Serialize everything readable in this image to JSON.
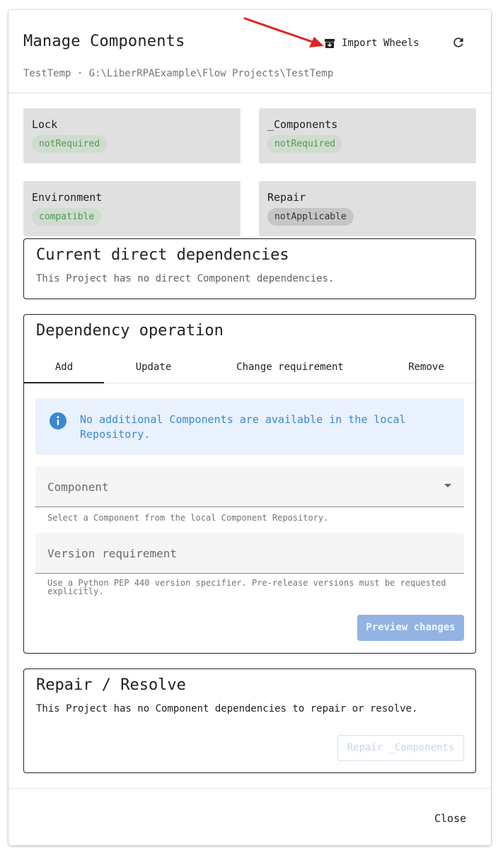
{
  "dialog": {
    "title": "Manage Components",
    "subtitle": "TestTemp · G:\\LiberRPAExample\\Flow Projects\\TestTemp",
    "import_label": "Import Wheels",
    "import_icon": "archive-icon",
    "refresh_icon": "refresh-icon",
    "annotation_color": "#e02424"
  },
  "status_cards": [
    {
      "label": "Lock",
      "value": "notRequired",
      "tone": "ok"
    },
    {
      "label": "_Components",
      "value": "notRequired",
      "tone": "ok"
    },
    {
      "label": "Environment",
      "value": "compatible",
      "tone": "ok"
    },
    {
      "label": "Repair",
      "value": "notApplicable",
      "tone": "neutral"
    }
  ],
  "current_deps": {
    "title": "Current direct dependencies",
    "text": "This Project has no direct Component dependencies."
  },
  "operation": {
    "title": "Dependency operation",
    "tabs": [
      {
        "label": "Add",
        "active": true
      },
      {
        "label": "Update",
        "active": false
      },
      {
        "label": "Change requirement",
        "active": false
      },
      {
        "label": "Remove",
        "active": false
      }
    ],
    "info_icon": "info-icon",
    "info_text": "No additional Components are available in the local Repository.",
    "component_field": {
      "placeholder": "Component",
      "helper": "Select a Component from the local Component Repository."
    },
    "version_field": {
      "placeholder": "Version requirement",
      "helper": "Use a Python PEP 440 version specifier. Pre-release versions must be requested explicitly."
    },
    "preview_label": "Preview changes"
  },
  "repair": {
    "title": "Repair / Resolve",
    "text": "This Project has no Component dependencies to repair or resolve.",
    "button_label": "Repair _Components"
  },
  "footer": {
    "close_label": "Close"
  },
  "colors": {
    "accent": "#3a87d4",
    "chip_ok_bg": "#cfdccf",
    "chip_ok_text": "#4e9a51",
    "disabled_primary": "#92b3e4"
  }
}
